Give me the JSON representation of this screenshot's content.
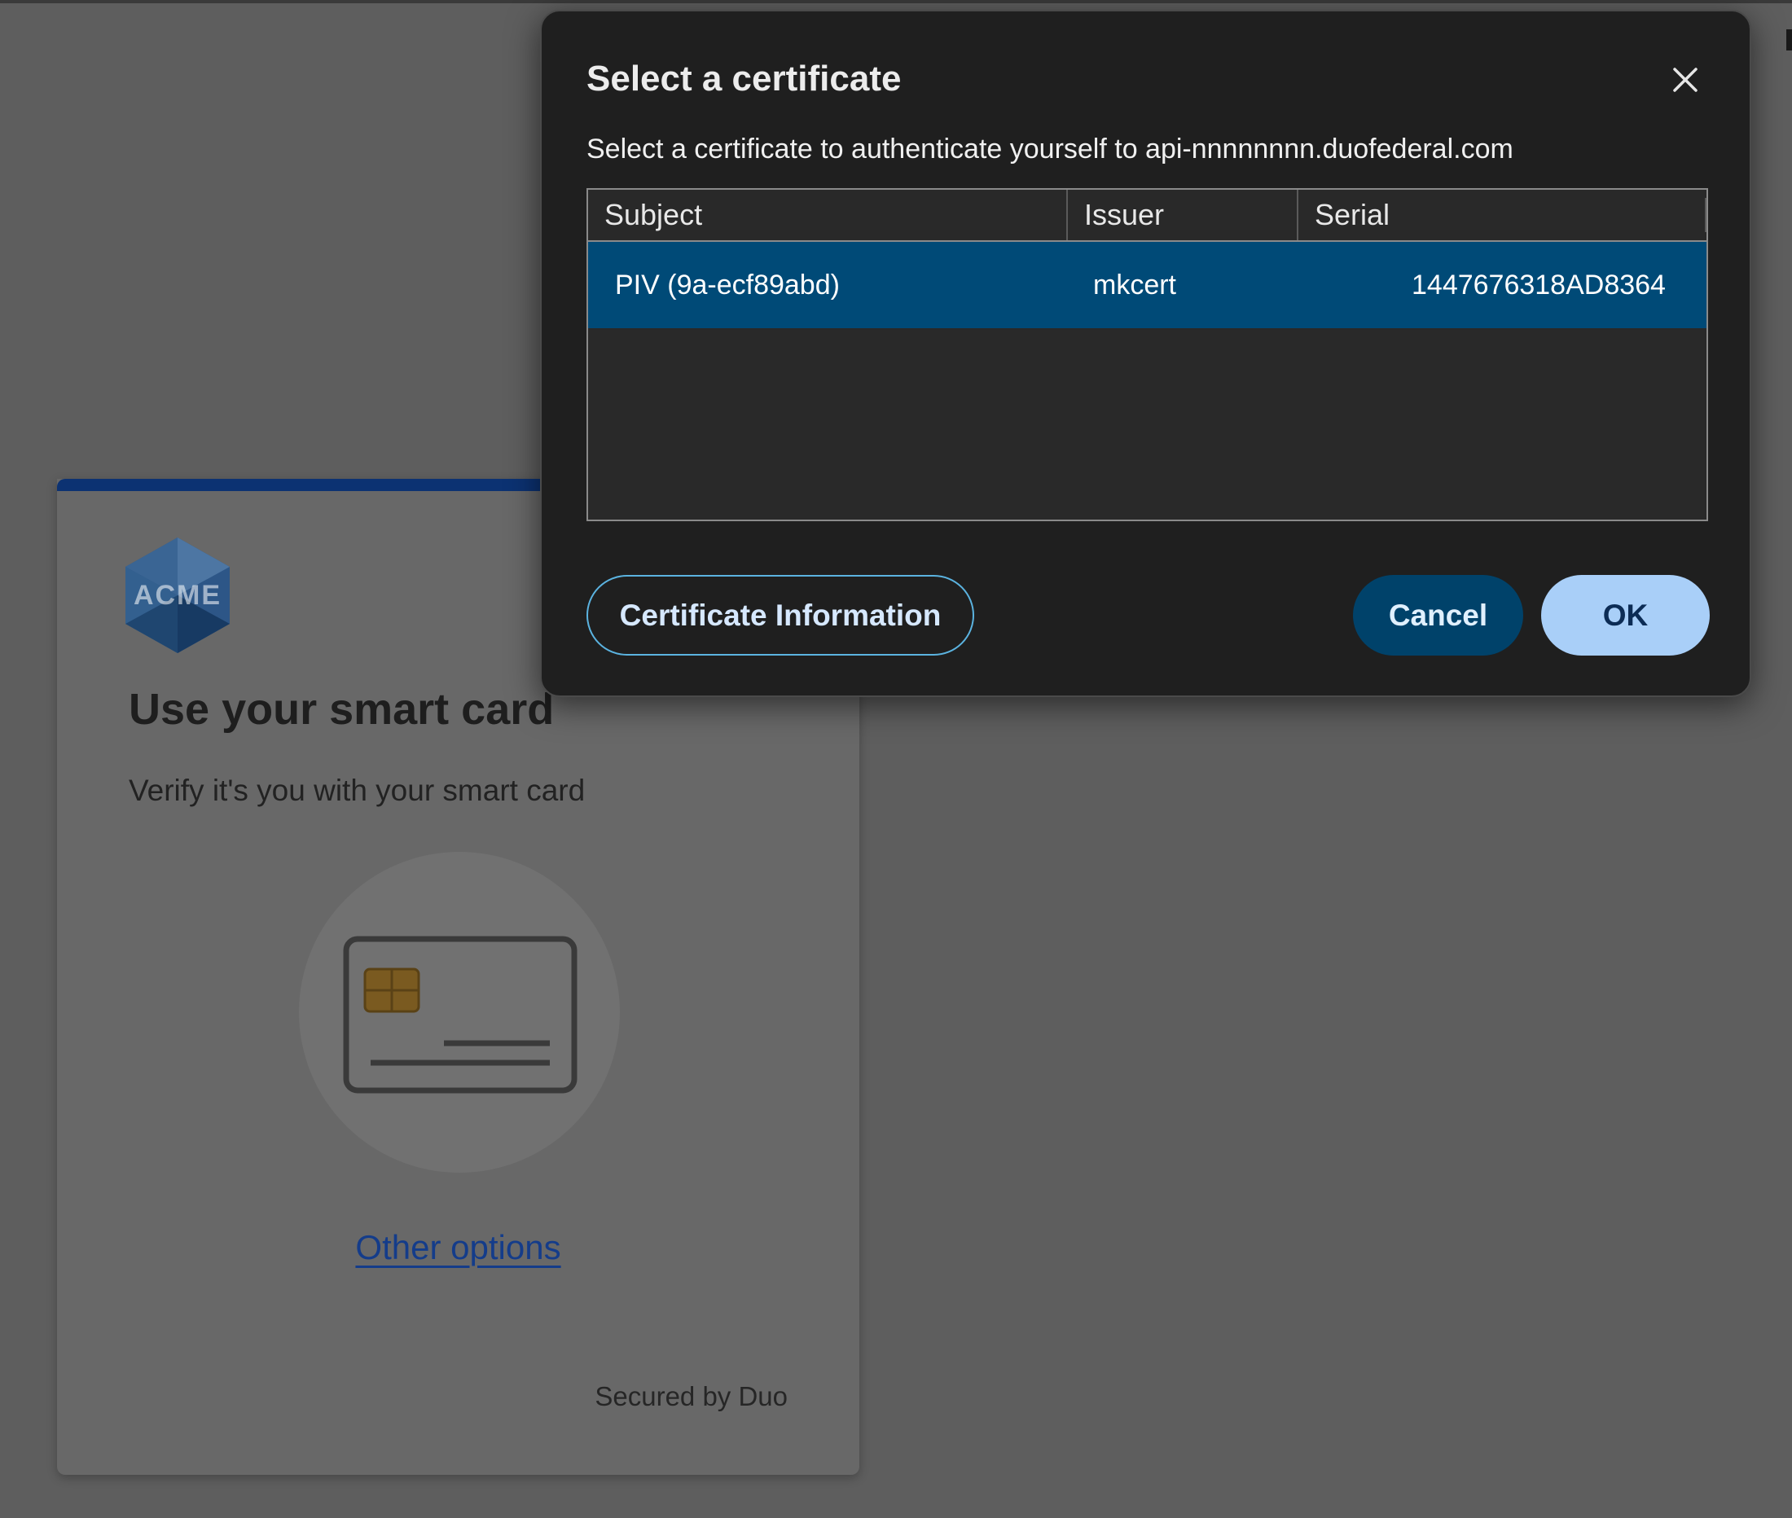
{
  "colors": {
    "overlay_bg": "#5e5e5e",
    "card_accent": "#0c3272",
    "dialog_bg": "#1f1f1f",
    "selected_row": "#004a77",
    "ok_button": "#a9cff8",
    "cancel_button": "#00426a",
    "link": "#143c8a"
  },
  "card": {
    "logo_text": "ACME",
    "title": "Use your smart card",
    "subtitle": "Verify it's you with your smart card",
    "icon": "smart-card-icon",
    "other_options_label": "Other options",
    "footer": "Secured by Duo"
  },
  "dialog": {
    "title": "Select a certificate",
    "description": "Select a certificate to authenticate yourself to api-nnnnnnnn.duofederal.com",
    "close_icon": "close-icon",
    "columns": [
      "Subject",
      "Issuer",
      "Serial"
    ],
    "rows": [
      {
        "subject": "PIV (9a-ecf89abd)",
        "issuer": "mkcert",
        "serial": "1447676318AD8364",
        "selected": true
      }
    ],
    "buttons": {
      "info": "Certificate Information",
      "cancel": "Cancel",
      "ok": "OK"
    }
  }
}
